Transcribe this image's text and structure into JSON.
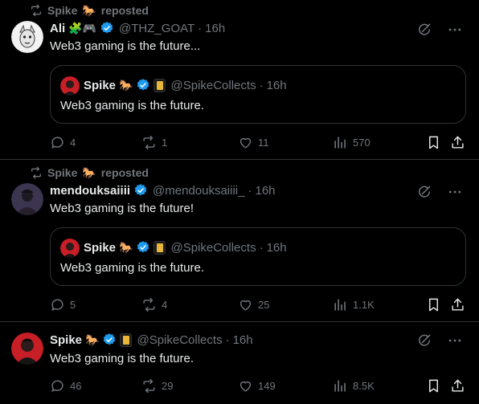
{
  "colors": {
    "background": "#000000",
    "text": "#e7e9ea",
    "muted": "#71767b",
    "divider": "#2f3336",
    "verified": "#1d9bf0"
  },
  "posts": [
    {
      "repost": {
        "user": "Spike",
        "user_emoji": "🐎",
        "label": "reposted"
      },
      "author": {
        "name": "Ali",
        "name_emojis": "🧩🎮",
        "handle": "@THZ_GOAT",
        "time": "16h"
      },
      "text": "Web3 gaming is the future...",
      "quote": {
        "author": {
          "name": "Spike",
          "name_emoji": "🐎",
          "handle": "@SpikeCollects",
          "time": "16h"
        },
        "text": "Web3 gaming is the future."
      },
      "stats": {
        "replies": "4",
        "reposts": "1",
        "likes": "11",
        "views": "570"
      }
    },
    {
      "repost": {
        "user": "Spike",
        "user_emoji": "🐎",
        "label": "reposted"
      },
      "author": {
        "name": "mendouksaiiii",
        "handle": "@mendouksaiiii_",
        "time": "16h"
      },
      "text": "Web3 gaming is the future!",
      "quote": {
        "author": {
          "name": "Spike",
          "name_emoji": "🐎",
          "handle": "@SpikeCollects",
          "time": "16h"
        },
        "text": "Web3 gaming is the future."
      },
      "stats": {
        "replies": "5",
        "reposts": "4",
        "likes": "25",
        "views": "1.1K"
      }
    },
    {
      "author": {
        "name": "Spike",
        "name_emoji": "🐎",
        "handle": "@SpikeCollects",
        "time": "16h"
      },
      "text": "Web3 gaming is the future.",
      "stats": {
        "replies": "46",
        "reposts": "29",
        "likes": "149",
        "views": "8.5K"
      }
    }
  ],
  "separator": "·",
  "icons": [
    "repost-icon",
    "verified-badge-icon",
    "gold-badge-icon",
    "grok-icon",
    "more-icon",
    "reply-icon",
    "like-icon",
    "views-icon",
    "bookmark-icon",
    "share-icon"
  ]
}
